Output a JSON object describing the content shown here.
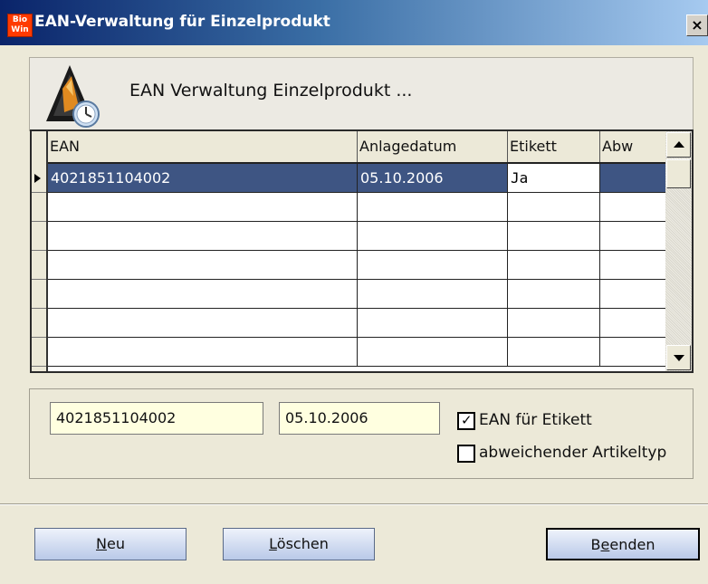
{
  "window": {
    "title": "EAN-Verwaltung für Einzelprodukt",
    "app_icon_top": "Bio",
    "app_icon_bottom": "Win",
    "close_label": "×"
  },
  "header": {
    "title": "EAN Verwaltung Einzelprodukt ..."
  },
  "grid": {
    "columns": [
      "EAN",
      "Anlagedatum",
      "Etikett",
      "Abw"
    ],
    "rows": [
      {
        "ean": "4021851104002",
        "date": "05.10.2006",
        "etikett": "Ja",
        "abw": ""
      }
    ]
  },
  "edit": {
    "ean_value": "4021851104002",
    "date_value": "05.10.2006",
    "checkbox_ean_label": "EAN für Etikett",
    "checkbox_ean_checked": true,
    "checkbox_abw_label": "abweichender Artikeltyp",
    "checkbox_abw_checked": false
  },
  "buttons": {
    "neu_first": "N",
    "neu_rest": "eu",
    "loeschen_first": "L",
    "loeschen_rest": "öschen",
    "beenden_pre": "B",
    "beenden_ul": "e",
    "beenden_rest": "enden"
  },
  "colors": {
    "selection": "#3e5583",
    "input_bg": "#ffffe0",
    "button_gradient_top": "#eef2fb",
    "button_gradient_bottom": "#b9c9e8"
  }
}
